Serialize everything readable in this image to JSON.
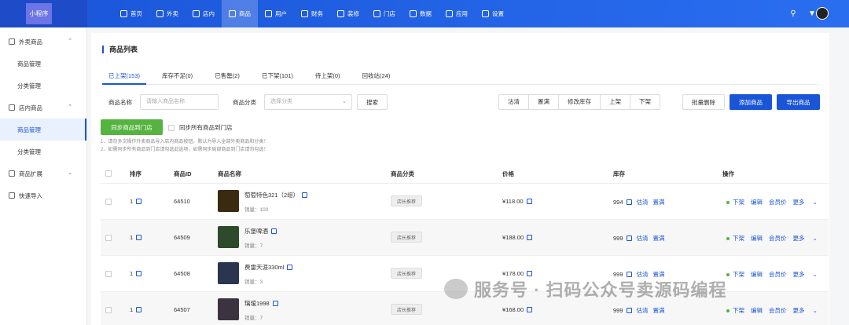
{
  "app": {
    "logo_text": "小程序"
  },
  "nav": [
    {
      "label": "首页",
      "active": false
    },
    {
      "label": "外卖",
      "active": false
    },
    {
      "label": "店内",
      "active": false
    },
    {
      "label": "商品",
      "active": true
    },
    {
      "label": "用户",
      "active": false
    },
    {
      "label": "财务",
      "active": false
    },
    {
      "label": "装修",
      "active": false
    },
    {
      "label": "门店",
      "active": false
    },
    {
      "label": "数据",
      "active": false
    },
    {
      "label": "应用",
      "active": false
    },
    {
      "label": "设置",
      "active": false
    }
  ],
  "sidebar": {
    "groups": [
      {
        "label": "外卖商品",
        "items": [
          "商品管理",
          "分类管理"
        ]
      },
      {
        "label": "店内商品",
        "items": [
          "商品管理",
          "分类管理"
        ]
      },
      {
        "label": "商品扩展",
        "items": []
      },
      {
        "label": "快速导入",
        "items": []
      }
    ],
    "active_item": "店内商品/商品管理"
  },
  "page": {
    "title": "商品列表"
  },
  "tabs": [
    {
      "label": "已上架(153)",
      "active": true
    },
    {
      "label": "库存不足(0)",
      "active": false
    },
    {
      "label": "已售罄(2)",
      "active": false
    },
    {
      "label": "已下架(101)",
      "active": false
    },
    {
      "label": "待上架(0)",
      "active": false
    },
    {
      "label": "回收站(24)",
      "active": false
    }
  ],
  "filters": {
    "name_label": "商品名称",
    "name_placeholder": "请输入商品名称",
    "category_label": "商品分类",
    "category_placeholder": "选择分类",
    "search_button": "搜索",
    "group_buttons": [
      "沽清",
      "置满",
      "修改库存",
      "上架",
      "下架"
    ],
    "batch_delete": "批量删除",
    "add_product": "添加商品",
    "export_product": "导出商品"
  },
  "sync": {
    "button": "同步商品到门店",
    "checkbox_label": "同步所有商品到门店",
    "note1": "1、请勿多次操作外卖商品导入店内商品按钮，默认为导入全部外卖商品和分类！",
    "note2": "2、如需同步所有商品到门店请勾选此选项，如需同步局部商品到门店请勿勾选！"
  },
  "table": {
    "headers": {
      "sort": "排序",
      "id": "商品ID",
      "name": "商品名称",
      "category": "商品分类",
      "price": "价格",
      "stock": "库存",
      "actions": "操作"
    },
    "rows": [
      {
        "sort": "1",
        "id": "64510",
        "name": "萄萄特色321（2组）",
        "sales": "销量：100",
        "tag": "店长推荐",
        "price": "¥118.00",
        "stock": "994",
        "thumb_color": "#3a2a10"
      },
      {
        "sort": "1",
        "id": "64509",
        "name": "乐堡啤酒",
        "sales": "销量：7",
        "tag": "店长推荐",
        "price": "¥188.00",
        "stock": "999",
        "thumb_color": "#2d4a2a"
      },
      {
        "sort": "1",
        "id": "64508",
        "name": "费雷天涯330ml",
        "sales": "销量：3",
        "tag": "店长推荐",
        "price": "¥178.00",
        "stock": "999",
        "thumb_color": "#2a3550"
      },
      {
        "sort": "1",
        "id": "64507",
        "name": "璃瑷1998",
        "sales": "销量：7",
        "tag": "店长推荐",
        "price": "¥168.00",
        "stock": "999",
        "thumb_color": "#3b3340"
      }
    ],
    "stock_links": [
      "估清",
      "置满"
    ],
    "row_actions": [
      "下架",
      "编辑",
      "会员价",
      "更多"
    ]
  },
  "watermark": {
    "text": "服务号 · 扫码公众号卖源码编程"
  },
  "colors": {
    "primary": "#1a55d8",
    "success": "#55b33f"
  }
}
